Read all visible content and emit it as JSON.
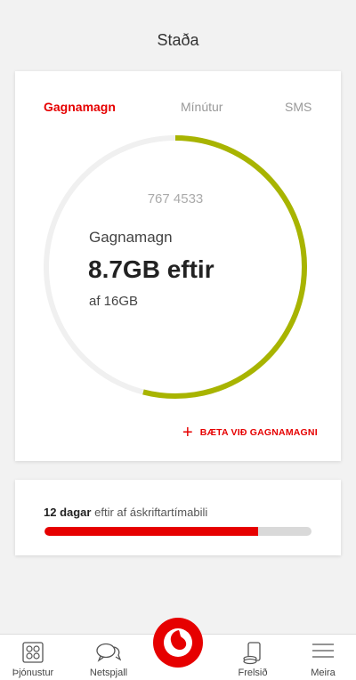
{
  "header": {
    "title": "Staða"
  },
  "tabs": [
    {
      "label": "Gagnamagn",
      "active": true
    },
    {
      "label": "Mínútur",
      "active": false
    },
    {
      "label": "SMS",
      "active": false
    }
  ],
  "usage": {
    "phone_number": "767 4533",
    "label": "Gagnamagn",
    "remaining": "8.7GB eftir",
    "total": "af 16GB",
    "remaining_fraction": 0.54,
    "ring_color": "#a8b400",
    "track_color": "#f0f0f0"
  },
  "add_data": {
    "icon": "plus-icon",
    "label": "BÆTA VIÐ GAGNAMAGNI"
  },
  "period": {
    "days": "12 dagar",
    "rest": "eftir af áskriftartímabili",
    "progress_fraction": 0.8,
    "bar_color": "#e60000"
  },
  "nav": [
    {
      "label": "Þjónustur",
      "icon": "services-grid-icon"
    },
    {
      "label": "Netspjall",
      "icon": "chat-bubbles-icon"
    },
    {
      "label": "",
      "icon": "vodafone-logo-icon"
    },
    {
      "label": "Frelsið",
      "icon": "phone-topup-icon"
    },
    {
      "label": "Meira",
      "icon": "menu-lines-icon"
    }
  ],
  "colors": {
    "accent": "#e60000",
    "data_ring": "#a8b400"
  }
}
